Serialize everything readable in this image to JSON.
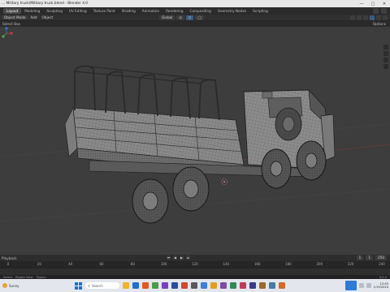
{
  "window": {
    "title": "... Military truck\\Military truck.blend - Blender 4.0",
    "controls": [
      "minimize-icon",
      "maximize-icon",
      "close-icon"
    ]
  },
  "workspace_tabs": [
    {
      "label": "Layout",
      "active": true
    },
    {
      "label": "Modeling",
      "active": false
    },
    {
      "label": "Sculpting",
      "active": false
    },
    {
      "label": "UV Editing",
      "active": false
    },
    {
      "label": "Texture Paint",
      "active": false
    },
    {
      "label": "Shading",
      "active": false
    },
    {
      "label": "Animation",
      "active": false
    },
    {
      "label": "Rendering",
      "active": false
    },
    {
      "label": "Compositing",
      "active": false
    },
    {
      "label": "Geometry Nodes",
      "active": false
    },
    {
      "label": "Scripting",
      "active": false
    }
  ],
  "header": {
    "menu": [
      "Add",
      "Object"
    ],
    "mode": "Object Mode",
    "transform_orientation": "Global"
  },
  "header2": {
    "select_box": "Select Box",
    "options": "Options"
  },
  "timeline": {
    "label": "Playback",
    "current_frame": "1",
    "start": "1",
    "end": "250",
    "ruler_ticks": [
      "0",
      "20",
      "40",
      "60",
      "80",
      "100",
      "120",
      "140",
      "160",
      "180",
      "200",
      "220",
      "240"
    ]
  },
  "statusbar": {
    "select": "Select",
    "rotate": "Rotate View",
    "context": "Object",
    "version": "4.0.2"
  },
  "taskbar": {
    "weather": "Sunny",
    "search_placeholder": "Search",
    "time": "12:45",
    "date": "1/15/2024"
  },
  "colors": {
    "accent": "#3d5a80",
    "viewport_bg": "#3d3d3d",
    "mesh_line": "#1e1e1e",
    "mesh_fill": "#8e8e8e"
  }
}
